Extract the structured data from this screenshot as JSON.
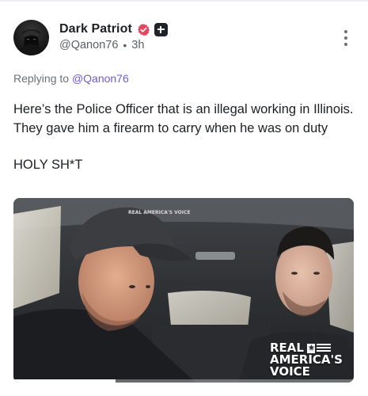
{
  "post": {
    "display_name": "Dark Patriot",
    "handle": "@Qanon76",
    "separator": "•",
    "time_ago": "3h",
    "replying_prefix": "Replying to",
    "replying_to": "@Qanon76",
    "body_paragraph_1": "Here’s the Police Officer that is an illegal working in Illinois. They gave him a firearm to carry when he was on duty",
    "body_paragraph_2": "HOLY SH*T"
  },
  "media": {
    "watermark_line1": "REAL",
    "watermark_line2": "AMERICA'S",
    "watermark_line3": "VOICE",
    "cap_text": "REAL AMERICA'S VOICE",
    "progress": 0.3
  },
  "icons": {
    "avatar": "hooded-figure-avatar",
    "verified": "verified-badge-icon",
    "plus": "plus-badge-icon",
    "more": "more-vertical-icon"
  },
  "colors": {
    "link": "#6d5bd0",
    "verified": "#e8455d",
    "muted": "#6b7075"
  }
}
